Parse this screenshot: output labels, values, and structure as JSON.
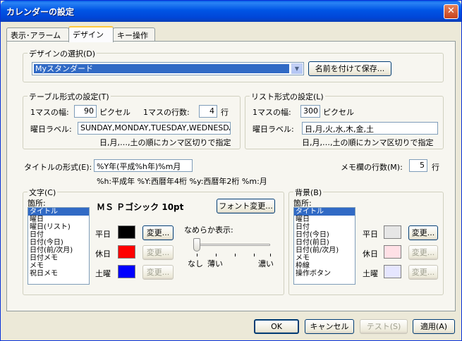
{
  "window": {
    "title": "カレンダーの設定",
    "close_label": "✕"
  },
  "tabs": [
    {
      "label": "表示･アラーム"
    },
    {
      "label": "デザイン"
    },
    {
      "label": "キー操作"
    }
  ],
  "design_select": {
    "legend": "デザインの選択(D)",
    "selected": "Myスタンダード",
    "save_as": "名前を付けて保存..."
  },
  "table_format": {
    "legend": "テーブル形式の設定(T)",
    "width_label": "1マスの幅:",
    "width_value": "90",
    "width_unit": "ピクセル",
    "rows_label": "1マスの行数:",
    "rows_value": "4",
    "rows_unit": "行",
    "weekday_label": "曜日ラベル:",
    "weekday_value": "SUNDAY,MONDAY,TUESDAY,WEDNESDA",
    "hint": "日,月,…,土の順にカンマ区切りで指定"
  },
  "list_format": {
    "legend": "リスト形式の設定(L)",
    "width_label": "1マスの幅:",
    "width_value": "300",
    "width_unit": "ピクセル",
    "weekday_label": "曜日ラベル:",
    "weekday_value": "日,月,火,水,木,金,土",
    "hint": "日,月,…,土の順にカンマ区切りで指定"
  },
  "title_format": {
    "label": "タイトルの形式(E):",
    "value": "%Y年(平成%h年)%m月",
    "hint": "%h:平成年  %Y:西暦年4桁  %y:西暦年2桁  %m:月"
  },
  "memo_rows": {
    "label": "メモ欄の行数(M):",
    "value": "5",
    "unit": "行"
  },
  "text_group": {
    "legend": "文字(C)",
    "places_label": "箇所:",
    "items": [
      "タイトル",
      "曜日",
      "曜日(リスト)",
      "日付",
      "日付(今日)",
      "日付(前/次月)",
      "日付メモ",
      "メモ",
      "祝日メモ"
    ],
    "selected_index": 0,
    "font_preview": "ＭＳ Ｐゴシック 10pt",
    "font_change": "フォント変更...",
    "weekday_label": "平日",
    "holiday_label": "休日",
    "saturday_label": "土曜",
    "change_label": "変更...",
    "weekday_color": "#000000",
    "holiday_color": "#ff0000",
    "saturday_color": "#0000ff",
    "smooth_label": "なめらか表示:",
    "smooth_none": "なし",
    "smooth_thin": "薄い",
    "smooth_dark": "濃い",
    "smooth_level": 0
  },
  "bg_group": {
    "legend": "背景(B)",
    "places_label": "箇所:",
    "items": [
      "タイトル",
      "曜日",
      "日付",
      "日付(今日)",
      "日付(前日)",
      "日付(前/次月)",
      "メモ",
      "枠線",
      "操作ボタン"
    ],
    "selected_index": 0,
    "weekday_label": "平日",
    "holiday_label": "休日",
    "saturday_label": "土曜",
    "change_label": "変更...",
    "weekday_color": "#e6e6e6",
    "holiday_color": "#ffe0e6",
    "saturday_color": "#e6e6ff"
  },
  "footer": {
    "ok": "OK",
    "cancel": "キャンセル",
    "test": "テスト(S)",
    "apply": "適用(A)"
  }
}
